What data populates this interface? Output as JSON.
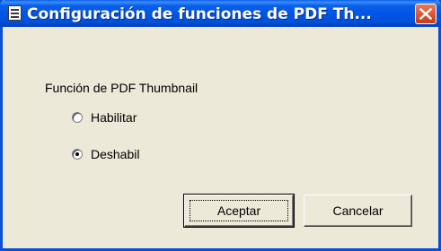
{
  "window": {
    "title": "Configuración de funciones de PDF Th...",
    "close_icon": "close-icon",
    "system_icon": "window-menu-icon"
  },
  "group": {
    "label": "Función de PDF Thumbnail"
  },
  "options": [
    {
      "label": "Habilitar",
      "selected": false
    },
    {
      "label": "Deshabil",
      "selected": true
    }
  ],
  "buttons": {
    "ok_label": "Aceptar",
    "cancel_label": "Cancelar"
  },
  "colors": {
    "titlebar": "#0055e5",
    "close_button": "#e05a37",
    "dialog_background": "#ece9d8"
  }
}
